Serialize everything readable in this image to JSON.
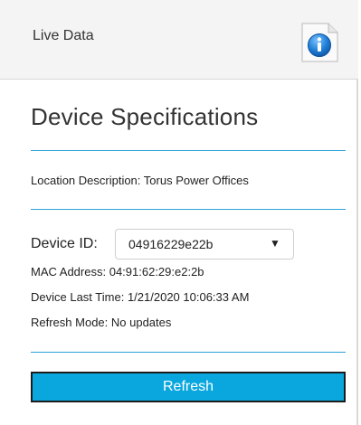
{
  "header": {
    "title": "Live Data",
    "info_icon": "info-icon"
  },
  "page_title": "Device Specifications",
  "location": {
    "label": "Location Description:",
    "value": "Torus Power Offices"
  },
  "device": {
    "label": "Device ID:",
    "selected": "04916229e22b",
    "caret_icon": "caret-down-icon"
  },
  "mac": {
    "label": "MAC Address:",
    "value": "04:91:62:29:e2:2b"
  },
  "last_time": {
    "label": "Device Last Time:",
    "value": "1/21/2020 10:06:33 AM"
  },
  "refresh_mode": {
    "label": "Refresh Mode:",
    "value": "No updates"
  },
  "refresh_button": {
    "label": "Refresh"
  },
  "colors": {
    "accent": "#0aa7df",
    "divider": "#2aa3d6",
    "header_bg": "#f4f4f4"
  }
}
